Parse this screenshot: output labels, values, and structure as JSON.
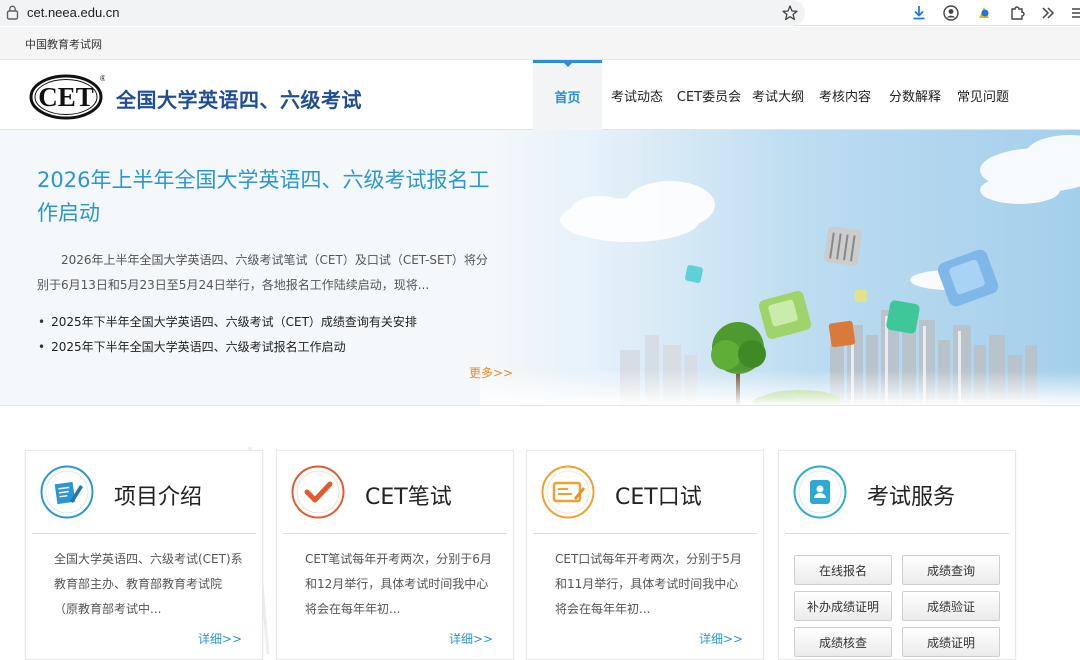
{
  "browser": {
    "url": "cet.neea.edu.cn",
    "icons": [
      "lock-icon",
      "star-icon",
      "download-icon",
      "account-icon",
      "extension-pin-icon",
      "puzzle-icon",
      "chevron-right-icon",
      "menu-icon"
    ]
  },
  "site_top": {
    "link": "中国教育考试网"
  },
  "header": {
    "logo_text": "CET",
    "logo_mark": "®",
    "title": "全国大学英语四、六级考试",
    "nav": [
      {
        "label": "首页",
        "active": true
      },
      {
        "label": "考试动态"
      },
      {
        "label": "CET委员会"
      },
      {
        "label": "考试大纲"
      },
      {
        "label": "考核内容"
      },
      {
        "label": "分数解释"
      },
      {
        "label": "常见问题"
      }
    ]
  },
  "banner": {
    "headline": "2026年上半年全国大学英语四、六级考试报名工作启动",
    "summary": "2026年上半年全国大学英语四、六级考试笔试（CET）及口试（CET-SET）将分别于6月13日和5月23日至5月24日举行，各地报名工作陆续启动，现将...",
    "news": [
      "2025年下半年全国大学英语四、六级考试（CET）成绩查询有关安排",
      "2025年下半年全国大学英语四、六级考试报名工作启动"
    ],
    "more": "更多>>"
  },
  "cards": [
    {
      "title": "项目介绍",
      "text": "全国大学英语四、六级考试(CET)系教育部主办、教育部教育考试院（原教育部考试中...",
      "more": "详细>>",
      "icon": "document-pen-icon",
      "color": "#2a97d4"
    },
    {
      "title": "CET笔试",
      "text": "CET笔试每年开考两次，分别于6月和12月举行，具体考试时间我中心将会在每年年初...",
      "more": "详细>>",
      "icon": "checkmark-icon",
      "color": "#e35a2c"
    },
    {
      "title": "CET口试",
      "text": "CET口试每年开考两次，分别于5月和11月举行，具体考试时间我中心将会在每年年初...",
      "more": "详细>>",
      "icon": "speaking-board-icon",
      "color": "#f0a030"
    },
    {
      "title": "考试服务",
      "icon": "id-card-icon",
      "color": "#2aaad4",
      "buttons": [
        "在线报名",
        "成绩查询",
        "补办成绩证明",
        "成绩验证",
        "成绩核查",
        "成绩证明"
      ]
    }
  ],
  "colors": {
    "accent": "#2a8fd6",
    "headline": "#2a97d4",
    "title": "#1f4e95",
    "more": "#f08a24"
  }
}
